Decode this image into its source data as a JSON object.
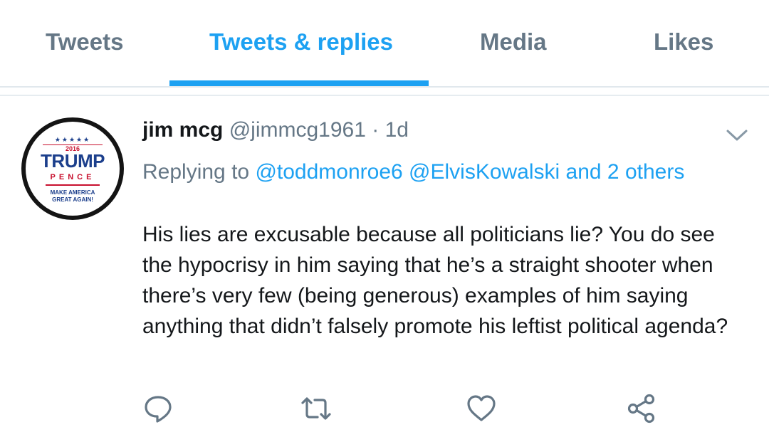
{
  "tabs": [
    {
      "label": "Tweets",
      "active": false
    },
    {
      "label": "Tweets & replies",
      "active": true
    },
    {
      "label": "Media",
      "active": false
    },
    {
      "label": "Likes",
      "active": false
    }
  ],
  "tweet": {
    "avatar": {
      "stars": "★★★★★",
      "year": "2016",
      "name": "TRUMP",
      "running_mate": "PENCE",
      "slogan_line1": "MAKE AMERICA",
      "slogan_line2": "GREAT AGAIN!"
    },
    "display_name": "jim mcg",
    "handle": "@jimmcg1961",
    "separator": "·",
    "time": "1d",
    "replying_to_prefix": "Replying to",
    "mentions": [
      "@toddmonroe6",
      "@ElvisKowalski"
    ],
    "and_others": "and 2 others",
    "text": "His lies are excusable because all politicians lie?  You do see the hypocrisy in him saying that he’s a straight shooter when there’s very few (being generous) examples of him saying anything that didn’t falsely promote his leftist political agenda?"
  },
  "actions": {
    "reply_icon": "reply-icon",
    "retweet_icon": "retweet-icon",
    "like_icon": "heart-icon",
    "share_icon": "share-icon",
    "menu_icon": "chevron-down-icon"
  },
  "colors": {
    "accent": "#1da1f2",
    "text_primary": "#14171a",
    "text_secondary": "#657786",
    "icon_gray": "#657786",
    "divider": "#e1e8ed"
  }
}
